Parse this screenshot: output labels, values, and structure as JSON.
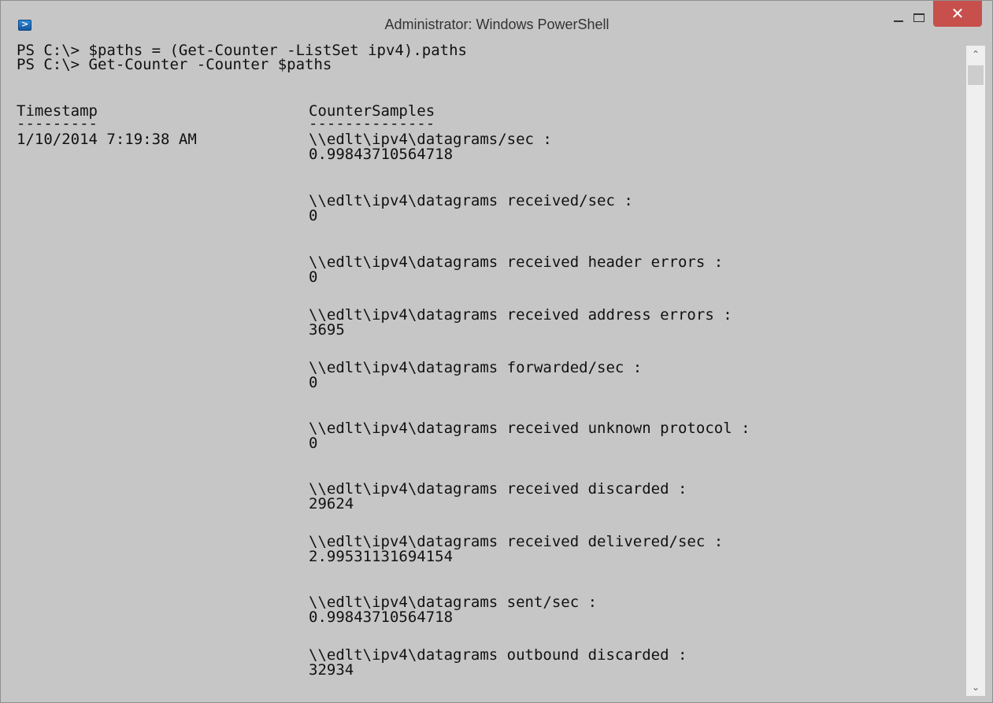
{
  "window": {
    "title": "Administrator: Windows PowerShell",
    "icon": "powershell-icon",
    "buttons": {
      "minimize": "minimize-icon",
      "maximize": "maximize-icon",
      "close": "close-icon",
      "close_glyph": "✕",
      "close_color": "#c7504c"
    }
  },
  "console": {
    "background": "#c6c6c6",
    "prompt_lines": [
      "PS C:\\> $paths = (Get-Counter -ListSet ipv4).paths",
      "PS C:\\> Get-Counter -Counter $paths"
    ],
    "headers": {
      "timestamp": "Timestamp",
      "counter_samples": "CounterSamples",
      "timestamp_underline": "---------",
      "counter_samples_underline": "--------------"
    },
    "timestamp_value": "1/10/2014 7:19:38 AM",
    "samples": [
      {
        "path": "\\\\edlt\\ipv4\\datagrams/sec :",
        "value": "0.99843710564718"
      },
      {
        "path": "\\\\edlt\\ipv4\\datagrams received/sec :",
        "value": "0"
      },
      {
        "path": "\\\\edlt\\ipv4\\datagrams received header errors :",
        "value": "0"
      },
      {
        "path": "\\\\edlt\\ipv4\\datagrams received address errors :",
        "value": "3695"
      },
      {
        "path": "\\\\edlt\\ipv4\\datagrams forwarded/sec :",
        "value": "0"
      },
      {
        "path": "\\\\edlt\\ipv4\\datagrams received unknown protocol :",
        "value": "0"
      },
      {
        "path": "\\\\edlt\\ipv4\\datagrams received discarded :",
        "value": "29624"
      },
      {
        "path": "\\\\edlt\\ipv4\\datagrams received delivered/sec :",
        "value": "2.99531131694154"
      },
      {
        "path": "\\\\edlt\\ipv4\\datagrams sent/sec :",
        "value": "0.99843710564718"
      },
      {
        "path": "\\\\edlt\\ipv4\\datagrams outbound discarded :",
        "value": "32934"
      }
    ]
  },
  "scrollbar": {
    "up_icon": "scroll-up-arrow-icon",
    "down_icon": "scroll-down-arrow-icon",
    "up_glyph": "⌃",
    "down_glyph": "⌄"
  }
}
